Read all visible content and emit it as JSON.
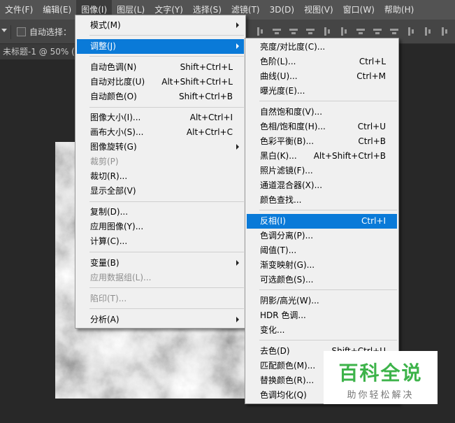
{
  "menubar": {
    "items": [
      "文件(F)",
      "编辑(E)",
      "图像(I)",
      "图层(L)",
      "文字(Y)",
      "选择(S)",
      "滤镜(T)",
      "3D(D)",
      "视图(V)",
      "窗口(W)",
      "帮助(H)"
    ]
  },
  "options": {
    "auto_select_label": "自动选择："
  },
  "document": {
    "tab_title": "未标题-1 @ 50% ("
  },
  "image_menu": [
    {
      "label": "模式(M)",
      "submenu": true
    },
    {
      "label": "调整(J)",
      "submenu": true,
      "highlighted": true
    },
    {
      "label": "自动色调(N)",
      "shortcut": "Shift+Ctrl+L"
    },
    {
      "label": "自动对比度(U)",
      "shortcut": "Alt+Shift+Ctrl+L"
    },
    {
      "label": "自动颜色(O)",
      "shortcut": "Shift+Ctrl+B"
    },
    {
      "label": "图像大小(I)...",
      "shortcut": "Alt+Ctrl+I"
    },
    {
      "label": "画布大小(S)...",
      "shortcut": "Alt+Ctrl+C"
    },
    {
      "label": "图像旋转(G)",
      "submenu": true
    },
    {
      "label": "裁剪(P)",
      "disabled": true
    },
    {
      "label": "裁切(R)..."
    },
    {
      "label": "显示全部(V)"
    },
    {
      "label": "复制(D)..."
    },
    {
      "label": "应用图像(Y)..."
    },
    {
      "label": "计算(C)..."
    },
    {
      "label": "变量(B)",
      "submenu": true
    },
    {
      "label": "应用数据组(L)...",
      "disabled": true
    },
    {
      "label": "陷印(T)...",
      "disabled": true
    },
    {
      "label": "分析(A)",
      "submenu": true
    }
  ],
  "adjust_menu": [
    {
      "label": "亮度/对比度(C)..."
    },
    {
      "label": "色阶(L)...",
      "shortcut": "Ctrl+L"
    },
    {
      "label": "曲线(U)...",
      "shortcut": "Ctrl+M"
    },
    {
      "label": "曝光度(E)..."
    },
    {
      "label": "自然饱和度(V)..."
    },
    {
      "label": "色相/饱和度(H)...",
      "shortcut": "Ctrl+U"
    },
    {
      "label": "色彩平衡(B)...",
      "shortcut": "Ctrl+B"
    },
    {
      "label": "黑白(K)...",
      "shortcut": "Alt+Shift+Ctrl+B"
    },
    {
      "label": "照片滤镜(F)..."
    },
    {
      "label": "通道混合器(X)..."
    },
    {
      "label": "颜色查找..."
    },
    {
      "label": "反相(I)",
      "shortcut": "Ctrl+I",
      "highlighted": true
    },
    {
      "label": "色调分离(P)..."
    },
    {
      "label": "阈值(T)..."
    },
    {
      "label": "渐变映射(G)..."
    },
    {
      "label": "可选颜色(S)..."
    },
    {
      "label": "阴影/高光(W)..."
    },
    {
      "label": "HDR 色调..."
    },
    {
      "label": "变化..."
    },
    {
      "label": "去色(D)",
      "shortcut": "Shift+Ctrl+U"
    },
    {
      "label": "匹配颜色(M)..."
    },
    {
      "label": "替换颜色(R)..."
    },
    {
      "label": "色调均化(Q)"
    }
  ],
  "watermark": {
    "title": "百科全说",
    "subtitle": "助你轻松解决"
  },
  "colors": {
    "menubar_bg": "#535353",
    "menu_bg": "#f0f0f0",
    "highlight": "#0a7ad8",
    "watermark_green": "#3db34a"
  }
}
